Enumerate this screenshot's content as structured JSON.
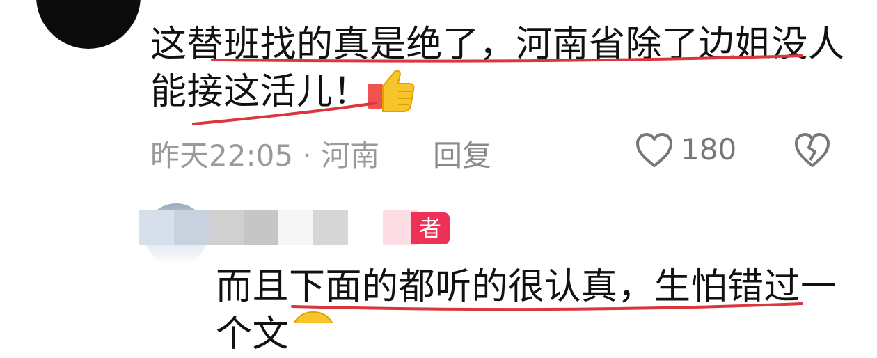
{
  "comment1": {
    "avatar_icon": "avatar-icon",
    "line1": "这替班找的真是绝了，河南省除了边姐没人",
    "line2": "能接这活儿！",
    "emoji": "thumbs-up-icon",
    "time": "昨天22:05 · 河南",
    "reply_label": "回复",
    "like_count": "180",
    "like_icon": "heart-outline-icon",
    "dislike_icon": "broken-heart-icon"
  },
  "comment2": {
    "badge": "者",
    "line1": "而且下面的都听的很认真，生怕错过一",
    "line2": "个文",
    "emoji": "emoji-icon"
  },
  "annotations": {
    "underline_color": "#d9363e"
  }
}
